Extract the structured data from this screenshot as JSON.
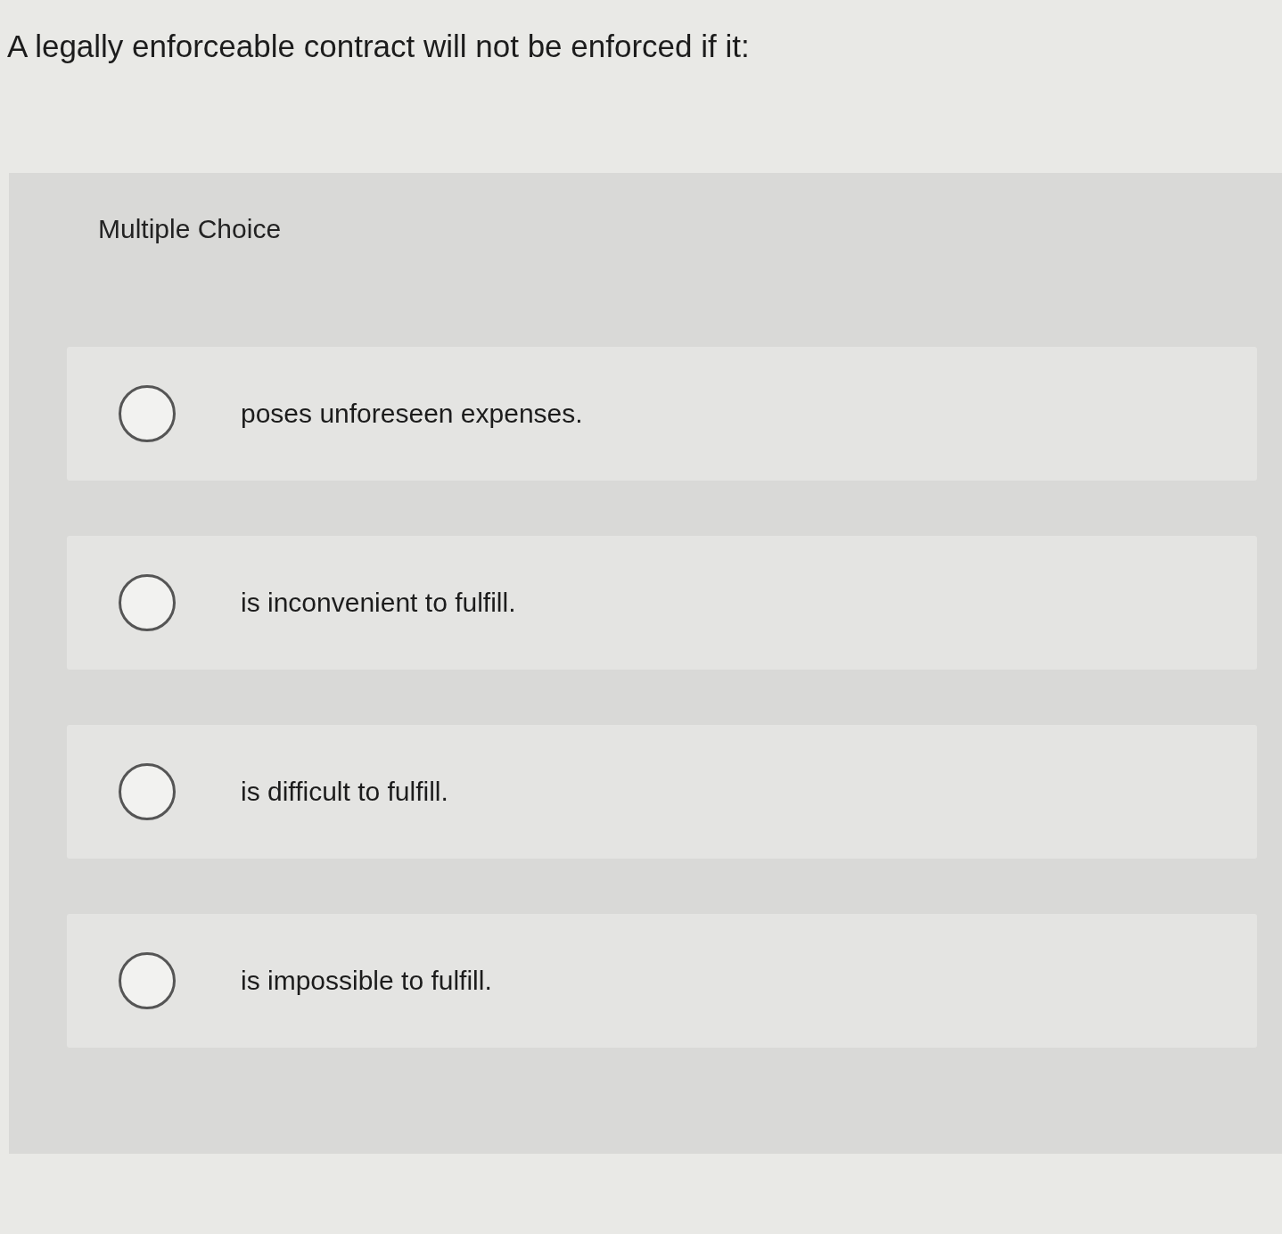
{
  "question": "A legally enforceable contract will not be enforced if it:",
  "panel": {
    "heading": "Multiple Choice",
    "options": [
      {
        "label": "poses unforeseen expenses.",
        "selected": false
      },
      {
        "label": "is inconvenient to fulfill.",
        "selected": false
      },
      {
        "label": "is difficult to fulfill.",
        "selected": false
      },
      {
        "label": "is impossible to fulfill.",
        "selected": false
      }
    ]
  }
}
